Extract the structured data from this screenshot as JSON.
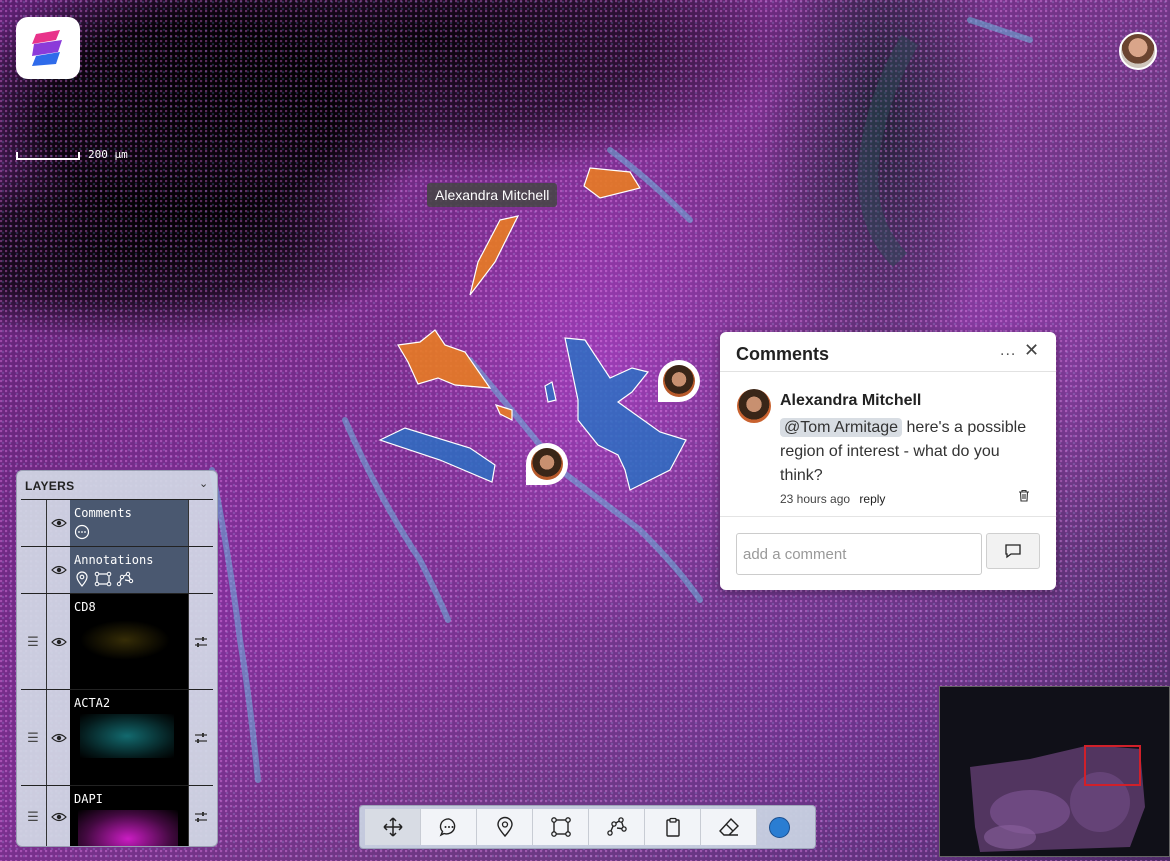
{
  "scale_bar": {
    "label": "200 µm"
  },
  "annotation_tooltip": {
    "author": "Alexandra Mitchell"
  },
  "comments_panel": {
    "title": "Comments",
    "more_label": "...",
    "close_label": "✕",
    "comment": {
      "author": "Alexandra Mitchell",
      "mention": "@Tom Armitage",
      "text": "here's a possible region of interest - what do you think?",
      "time": "23 hours ago",
      "reply_label": "reply"
    },
    "input_placeholder": "add a comment"
  },
  "layers": {
    "title": "LAYERS",
    "items": [
      {
        "name": "Comments",
        "color": "#4a5870"
      },
      {
        "name": "Annotations",
        "color": "#4a5870"
      },
      {
        "name": "CD8",
        "color": "#d4b11a"
      },
      {
        "name": "ACTA2",
        "color": "#1fb0b8"
      },
      {
        "name": "DAPI",
        "color": "#e020d8"
      }
    ]
  },
  "toolbar": {
    "tools": [
      "move-icon",
      "comment-icon",
      "pin-icon",
      "polygon-icon",
      "polyline-icon",
      "clipboard-icon",
      "eraser-icon"
    ],
    "active_tool": "move-icon",
    "annotation_color": "#2a7dd2"
  },
  "colors": {
    "annotation_orange": "#e87b22",
    "annotation_blue": "#2b6fc2",
    "minimap_viewport": "#d0202a"
  }
}
